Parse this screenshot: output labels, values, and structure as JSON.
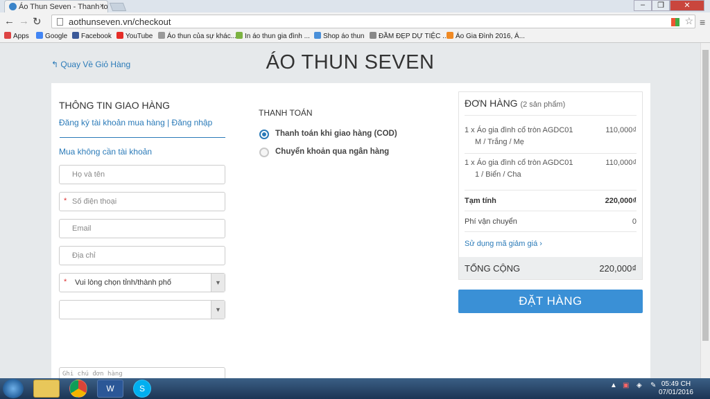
{
  "browser": {
    "tab_title": "Áo Thun Seven - Thanh to",
    "tab_close": "×",
    "url": "aothunseven.vn/checkout",
    "back_icon": "←",
    "forward_icon": "→",
    "reload_icon": "↻",
    "home_icon": "⌂",
    "star_icon": "☆",
    "menu_icon": "≡",
    "window_controls": {
      "minimize": "–",
      "restore": "❐",
      "close": "✕"
    },
    "bookmarks": [
      {
        "label": "Apps",
        "color": "#d44"
      },
      {
        "label": "Google",
        "color": "#4285f4"
      },
      {
        "label": "Facebook",
        "color": "#3b5998"
      },
      {
        "label": "YouTube",
        "color": "#e52d27"
      },
      {
        "label": "Áo thun của sự khác...",
        "color": "#999"
      },
      {
        "label": "In áo thun gia đình ...",
        "color": "#7cb342"
      },
      {
        "label": "Shop áo thun",
        "color": "#4a90d9"
      },
      {
        "label": "ĐẦM ĐẸP DỰ TIỆC ...",
        "color": "#888"
      },
      {
        "label": "Áo Gia Đình 2016, Á...",
        "color": "#f08a24"
      }
    ]
  },
  "page": {
    "back_link": "Quay Về Giỏ Hàng",
    "brand": "ÁO THUN SEVEN",
    "shipping": {
      "title": "THÔNG TIN GIAO HÀNG",
      "auth_link": "Đăng ký tài khoản mua hàng | Đăng nhập",
      "guest_link": "Mua không cần tài khoản",
      "name_placeholder": "Họ và tên",
      "phone_placeholder": "Số điện thoại",
      "email_placeholder": "Email",
      "address_placeholder": "Địa chỉ",
      "city_select": "Vui lòng chọn tỉnh/thành phố",
      "district_select": "",
      "note_placeholder": "Ghi chú đơn hàng",
      "required_mark": "*"
    },
    "payment": {
      "title": "THANH TOÁN",
      "options": [
        {
          "label": "Thanh toán khi giao hàng (COD)",
          "selected": true
        },
        {
          "label": "Chuyển khoản qua ngân hàng",
          "selected": false
        }
      ]
    },
    "order": {
      "title": "ĐƠN HÀNG",
      "count": "(2 sản phẩm)",
      "items": [
        {
          "name": "1 x Áo gia đình cổ tròn AGDC01",
          "variant": "M / Trắng / Mẹ",
          "price": "110,000₫"
        },
        {
          "name": "1 x Áo gia đình cổ tròn AGDC01",
          "variant": "1 / Biển / Cha",
          "price": "110,000₫"
        }
      ],
      "subtotal_label": "Tạm tính",
      "subtotal": "220,000₫",
      "shipping_label": "Phí vận chuyển",
      "shipping": "0",
      "coupon_link": "Sử dụng mã giảm giá ›",
      "total_label": "TỔNG CỘNG",
      "total": "220,000₫",
      "place_order": "ĐẶT HÀNG"
    }
  },
  "taskbar": {
    "time": "05:49 CH",
    "date": "07/01/2016",
    "apps": [
      "explorer",
      "chrome",
      "word",
      "skype"
    ]
  }
}
